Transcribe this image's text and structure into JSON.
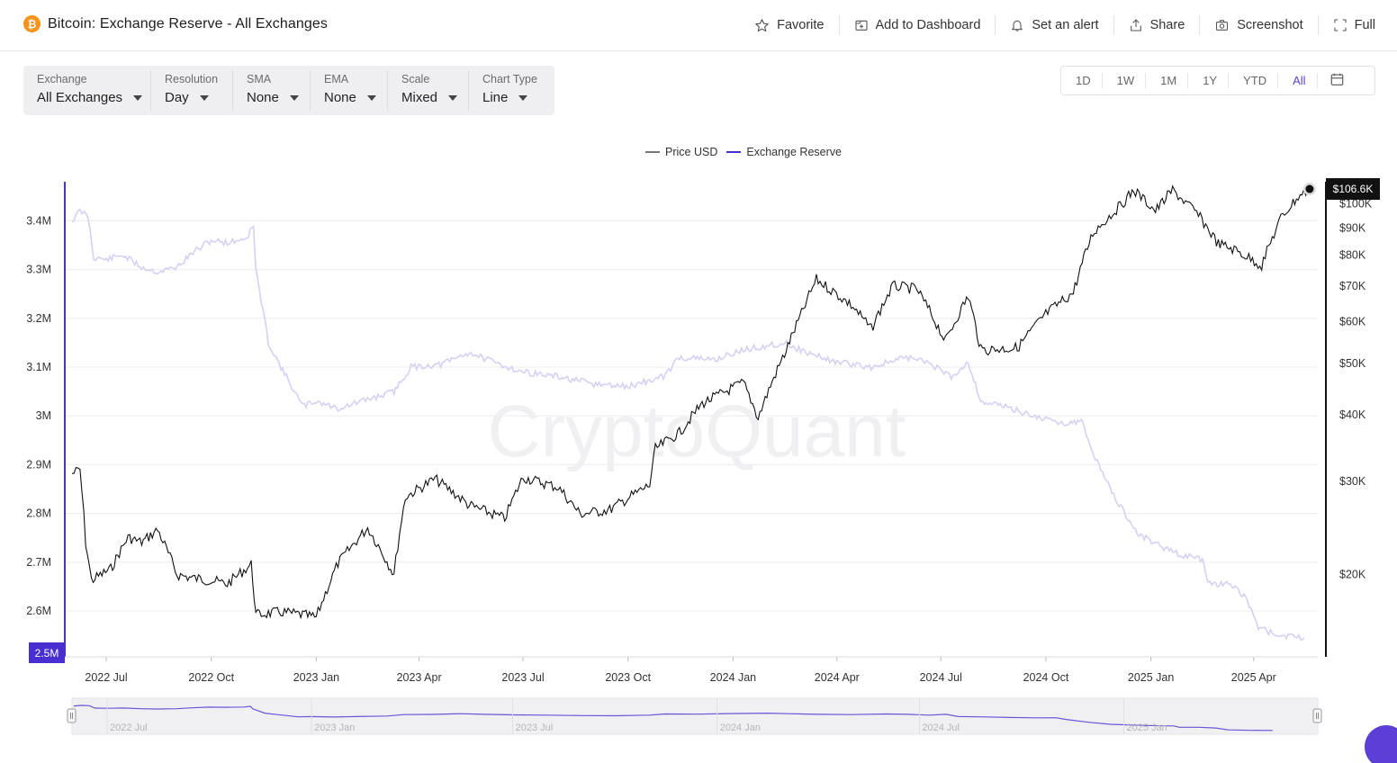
{
  "header": {
    "btc_symbol": "₿",
    "title": "Bitcoin: Exchange Reserve - All Exchanges",
    "actions": [
      {
        "label": "Favorite",
        "icon": "star-icon"
      },
      {
        "label": "Add to Dashboard",
        "icon": "add-dashboard-icon"
      },
      {
        "label": "Set an alert",
        "icon": "bell-icon"
      },
      {
        "label": "Share",
        "icon": "share-icon"
      },
      {
        "label": "Screenshot",
        "icon": "camera-icon"
      },
      {
        "label": "Full",
        "icon": "fullscreen-icon"
      }
    ]
  },
  "filters": [
    {
      "label": "Exchange",
      "value": "All Exchanges"
    },
    {
      "label": "Resolution",
      "value": "Day"
    },
    {
      "label": "SMA",
      "value": "None"
    },
    {
      "label": "EMA",
      "value": "None"
    },
    {
      "label": "Scale",
      "value": "Mixed"
    },
    {
      "label": "Chart Type",
      "value": "Line"
    }
  ],
  "ranges": [
    "1D",
    "1W",
    "1M",
    "1Y",
    "YTD",
    "All"
  ],
  "active_range": "All",
  "watermark": "CryptoQuant",
  "colors": {
    "price_line": "#111111",
    "reserve_line": "#d6d0f3",
    "accent": "#4a2fd0",
    "grid": "#ececec"
  },
  "chart_data": {
    "type": "line",
    "legend": [
      "Price USD",
      "Exchange Reserve"
    ],
    "legend_placement": "top-center",
    "grid": true,
    "x_ticks": [
      "2022 Jul",
      "2022 Oct",
      "2023 Jan",
      "2023 Apr",
      "2023 Jul",
      "2023 Oct",
      "2024 Jan",
      "2024 Apr",
      "2024 Jul",
      "2024 Oct",
      "2025 Jan",
      "2025 Apr"
    ],
    "y_left": {
      "label": "Exchange Reserve",
      "ticks": [
        "3.4M",
        "3.3M",
        "3.2M",
        "3.1M",
        "3M",
        "2.9M",
        "2.8M",
        "2.7M",
        "2.6M"
      ],
      "tick_values": [
        3400000,
        3300000,
        3200000,
        3100000,
        3000000,
        2900000,
        2800000,
        2700000,
        2600000
      ],
      "range": [
        2506000,
        3480000
      ],
      "current_label": "2.5M"
    },
    "y_right": {
      "label": "Price USD",
      "scale": "log",
      "ticks": [
        "$100K",
        "$90K",
        "$80K",
        "$70K",
        "$60K",
        "$50K",
        "$40K",
        "$30K",
        "$20K"
      ],
      "tick_values": [
        100000,
        90000,
        80000,
        70000,
        60000,
        50000,
        40000,
        30000,
        20000
      ],
      "range": [
        14000,
        110000
      ],
      "current_label": "$106.6K"
    },
    "series": [
      {
        "name": "Exchange Reserve",
        "points": [
          [
            "2022-06-01",
            3400000
          ],
          [
            "2022-06-08",
            3420000
          ],
          [
            "2022-06-15",
            3410000
          ],
          [
            "2022-06-20",
            3325000
          ],
          [
            "2022-07-01",
            3320000
          ],
          [
            "2022-07-15",
            3330000
          ],
          [
            "2022-08-01",
            3305000
          ],
          [
            "2022-08-15",
            3295000
          ],
          [
            "2022-09-01",
            3305000
          ],
          [
            "2022-09-15",
            3335000
          ],
          [
            "2022-10-01",
            3360000
          ],
          [
            "2022-10-15",
            3355000
          ],
          [
            "2022-11-01",
            3365000
          ],
          [
            "2022-11-07",
            3390000
          ],
          [
            "2022-11-09",
            3300000
          ],
          [
            "2022-11-20",
            3150000
          ],
          [
            "2022-12-01",
            3100000
          ],
          [
            "2022-12-20",
            3020000
          ],
          [
            "2023-01-01",
            3030000
          ],
          [
            "2023-01-20",
            3015000
          ],
          [
            "2023-02-10",
            3030000
          ],
          [
            "2023-03-10",
            3050000
          ],
          [
            "2023-03-25",
            3100000
          ],
          [
            "2023-04-20",
            3105000
          ],
          [
            "2023-05-15",
            3130000
          ],
          [
            "2023-06-05",
            3110000
          ],
          [
            "2023-07-01",
            3090000
          ],
          [
            "2023-08-01",
            3080000
          ],
          [
            "2023-09-01",
            3065000
          ],
          [
            "2023-10-01",
            3060000
          ],
          [
            "2023-11-01",
            3080000
          ],
          [
            "2023-11-15",
            3120000
          ],
          [
            "2023-12-15",
            3115000
          ],
          [
            "2024-01-10",
            3135000
          ],
          [
            "2024-02-15",
            3150000
          ],
          [
            "2024-03-05",
            3130000
          ],
          [
            "2024-04-01",
            3110000
          ],
          [
            "2024-05-01",
            3100000
          ],
          [
            "2024-06-01",
            3120000
          ],
          [
            "2024-06-20",
            3110000
          ],
          [
            "2024-07-10",
            3080000
          ],
          [
            "2024-07-25",
            3110000
          ],
          [
            "2024-08-05",
            3030000
          ],
          [
            "2024-08-25",
            3020000
          ],
          [
            "2024-09-20",
            3000000
          ],
          [
            "2024-10-15",
            2985000
          ],
          [
            "2024-11-01",
            2990000
          ],
          [
            "2024-11-10",
            2930000
          ],
          [
            "2024-12-01",
            2830000
          ],
          [
            "2024-12-20",
            2760000
          ],
          [
            "2025-01-20",
            2720000
          ],
          [
            "2025-02-15",
            2705000
          ],
          [
            "2025-02-20",
            2655000
          ],
          [
            "2025-03-10",
            2655000
          ],
          [
            "2025-03-25",
            2630000
          ],
          [
            "2025-04-05",
            2565000
          ],
          [
            "2025-04-25",
            2550000
          ],
          [
            "2025-05-15",
            2545000
          ]
        ]
      },
      {
        "name": "Price USD",
        "points": [
          [
            "2022-06-01",
            31000
          ],
          [
            "2022-06-08",
            31500
          ],
          [
            "2022-06-13",
            23000
          ],
          [
            "2022-06-18",
            19500
          ],
          [
            "2022-07-05",
            20500
          ],
          [
            "2022-07-20",
            23500
          ],
          [
            "2022-08-01",
            23000
          ],
          [
            "2022-08-15",
            24300
          ],
          [
            "2022-09-01",
            20000
          ],
          [
            "2022-09-15",
            19700
          ],
          [
            "2022-10-01",
            19500
          ],
          [
            "2022-10-15",
            19200
          ],
          [
            "2022-11-05",
            20900
          ],
          [
            "2022-11-09",
            16800
          ],
          [
            "2022-12-01",
            17000
          ],
          [
            "2022-12-20",
            16800
          ],
          [
            "2023-01-01",
            16600
          ],
          [
            "2023-01-20",
            21000
          ],
          [
            "2023-02-15",
            24500
          ],
          [
            "2023-03-10",
            20000
          ],
          [
            "2023-03-20",
            28000
          ],
          [
            "2023-04-15",
            30300
          ],
          [
            "2023-05-15",
            27000
          ],
          [
            "2023-06-15",
            25500
          ],
          [
            "2023-07-01",
            30500
          ],
          [
            "2023-08-01",
            29200
          ],
          [
            "2023-08-20",
            26000
          ],
          [
            "2023-09-15",
            26500
          ],
          [
            "2023-10-20",
            29500
          ],
          [
            "2023-10-25",
            34500
          ],
          [
            "2023-11-15",
            37000
          ],
          [
            "2023-12-05",
            42000
          ],
          [
            "2024-01-10",
            46000
          ],
          [
            "2024-01-23",
            39500
          ],
          [
            "2024-02-15",
            52000
          ],
          [
            "2024-03-01",
            62000
          ],
          [
            "2024-03-14",
            72000
          ],
          [
            "2024-04-15",
            64000
          ],
          [
            "2024-05-01",
            58000
          ],
          [
            "2024-05-20",
            70000
          ],
          [
            "2024-06-10",
            69000
          ],
          [
            "2024-07-05",
            55000
          ],
          [
            "2024-07-25",
            67000
          ],
          [
            "2024-08-05",
            53000
          ],
          [
            "2024-09-06",
            53500
          ],
          [
            "2024-10-01",
            62000
          ],
          [
            "2024-10-25",
            68000
          ],
          [
            "2024-11-11",
            88000
          ],
          [
            "2024-12-05",
            99000
          ],
          [
            "2024-12-17",
            106000
          ],
          [
            "2025-01-05",
            97000
          ],
          [
            "2025-01-20",
            106000
          ],
          [
            "2025-02-10",
            96000
          ],
          [
            "2025-03-01",
            84000
          ],
          [
            "2025-03-15",
            82000
          ],
          [
            "2025-04-08",
            76500
          ],
          [
            "2025-04-25",
            94000
          ],
          [
            "2025-05-10",
            103000
          ],
          [
            "2025-05-20",
            106600
          ]
        ]
      }
    ]
  }
}
